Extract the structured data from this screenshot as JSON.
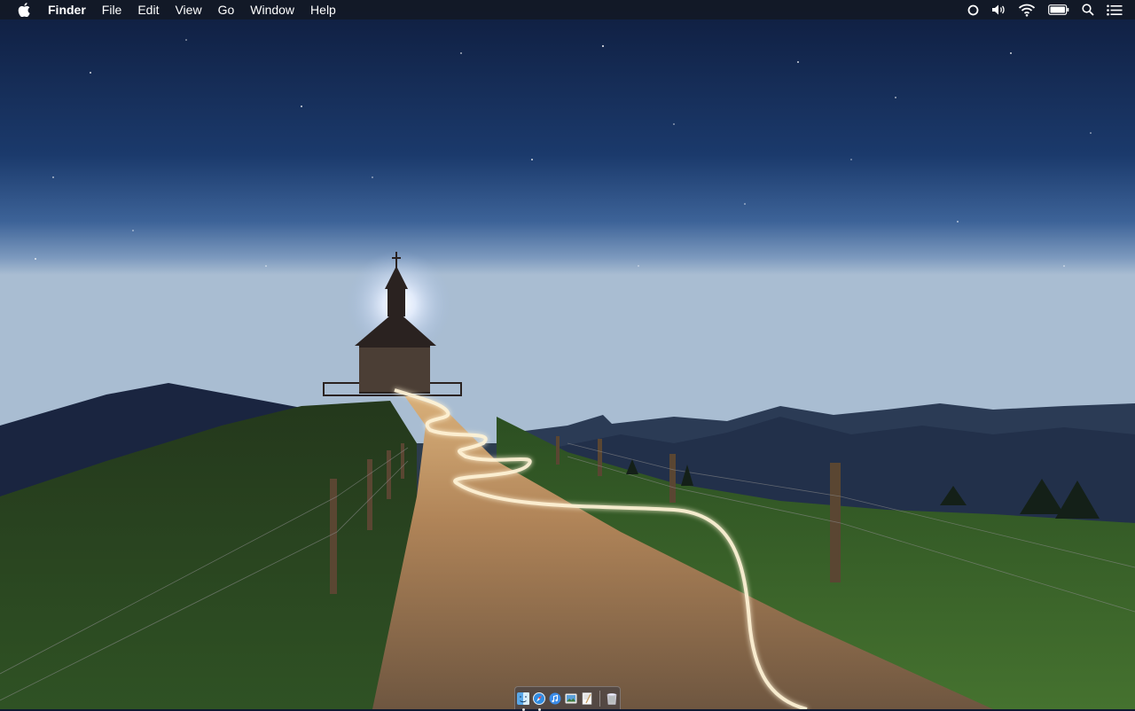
{
  "menubar": {
    "app_name": "Finder",
    "menus": [
      "File",
      "Edit",
      "View",
      "Go",
      "Window",
      "Help"
    ],
    "apple_icon": "apple-logo-icon",
    "status_icons": [
      "siri-icon",
      "volume-icon",
      "wifi-icon",
      "battery-icon",
      "spotlight-search-icon",
      "notification-center-icon"
    ]
  },
  "dock": {
    "items": [
      {
        "name": "finder",
        "icon": "finder-icon",
        "running": true
      },
      {
        "name": "safari",
        "icon": "safari-icon",
        "running": true
      },
      {
        "name": "itunes",
        "icon": "itunes-icon",
        "running": false
      },
      {
        "name": "preview",
        "icon": "preview-icon",
        "running": false
      },
      {
        "name": "textedit",
        "icon": "textedit-icon",
        "running": false
      }
    ],
    "trash_icon": "trash-icon"
  },
  "wallpaper": {
    "description_colors": {
      "sky_top": "#0e1c3c",
      "sky_horizon": "#8fa8c4",
      "grass": "#3f6a2a",
      "path": "#8a6a48",
      "light_trail": "#fff2d0"
    }
  }
}
